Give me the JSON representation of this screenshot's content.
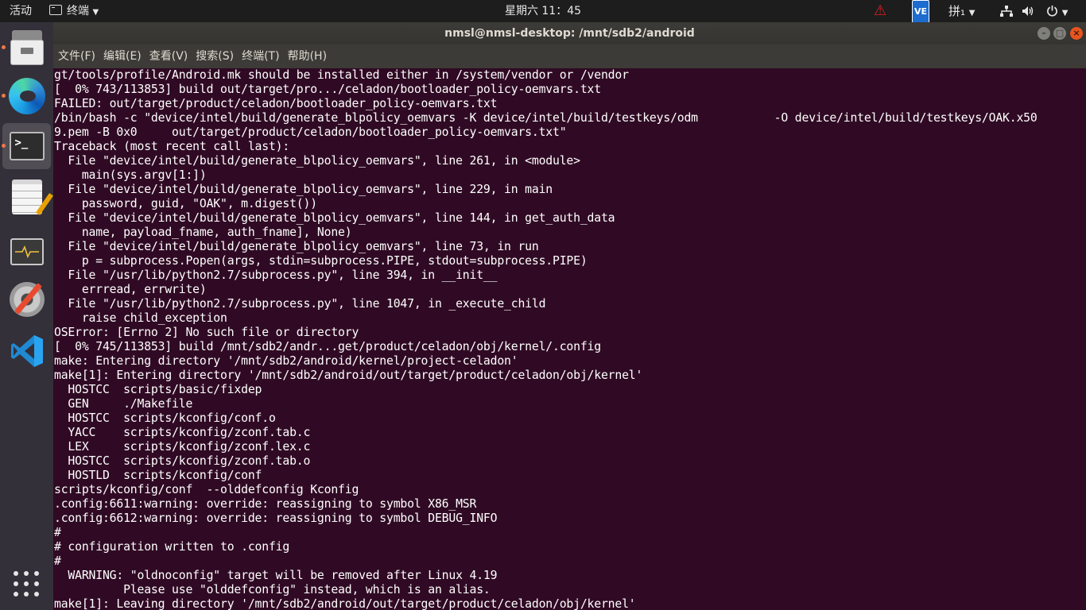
{
  "topbar": {
    "activities": "活动",
    "app_name": "终端",
    "clock": "星期六 11：45",
    "ime": "拼₁",
    "ve_label": "VE",
    "icons": [
      "warning-icon",
      "ve-icon",
      "network-icon",
      "volume-icon",
      "power-icon"
    ]
  },
  "dock": {
    "apps": [
      "files-icon",
      "edge-icon",
      "terminal-icon",
      "text-editor-icon",
      "system-monitor-icon",
      "settings-icon",
      "vscode-icon",
      "show-apps-icon"
    ],
    "terminal_prompt": ">_"
  },
  "window": {
    "title": "nmsl@nmsl-desktop: /mnt/sdb2/android",
    "menu": [
      "文件(F)",
      "编辑(E)",
      "查看(V)",
      "搜索(S)",
      "终端(T)",
      "帮助(H)"
    ]
  },
  "terminal": {
    "lines": [
      "gt/tools/profile/Android.mk should be installed either in /system/vendor or /vendor",
      "[  0% 743/113853] build out/target/pro.../celadon/bootloader_policy-oemvars.txt",
      "FAILED: out/target/product/celadon/bootloader_policy-oemvars.txt",
      "/bin/bash -c \"device/intel/build/generate_blpolicy_oemvars -K device/intel/build/testkeys/odm           -O device/intel/build/testkeys/OAK.x50",
      "9.pem -B 0x0     out/target/product/celadon/bootloader_policy-oemvars.txt\"",
      "Traceback (most recent call last):",
      "  File \"device/intel/build/generate_blpolicy_oemvars\", line 261, in <module>",
      "    main(sys.argv[1:])",
      "  File \"device/intel/build/generate_blpolicy_oemvars\", line 229, in main",
      "    password, guid, \"OAK\", m.digest())",
      "  File \"device/intel/build/generate_blpolicy_oemvars\", line 144, in get_auth_data",
      "    name, payload_fname, auth_fname], None)",
      "  File \"device/intel/build/generate_blpolicy_oemvars\", line 73, in run",
      "    p = subprocess.Popen(args, stdin=subprocess.PIPE, stdout=subprocess.PIPE)",
      "  File \"/usr/lib/python2.7/subprocess.py\", line 394, in __init__",
      "    errread, errwrite)",
      "  File \"/usr/lib/python2.7/subprocess.py\", line 1047, in _execute_child",
      "    raise child_exception",
      "OSError: [Errno 2] No such file or directory",
      "[  0% 745/113853] build /mnt/sdb2/andr...get/product/celadon/obj/kernel/.config",
      "make: Entering directory '/mnt/sdb2/android/kernel/project-celadon'",
      "make[1]: Entering directory '/mnt/sdb2/android/out/target/product/celadon/obj/kernel'",
      "  HOSTCC  scripts/basic/fixdep",
      "  GEN     ./Makefile",
      "  HOSTCC  scripts/kconfig/conf.o",
      "  YACC    scripts/kconfig/zconf.tab.c",
      "  LEX     scripts/kconfig/zconf.lex.c",
      "  HOSTCC  scripts/kconfig/zconf.tab.o",
      "  HOSTLD  scripts/kconfig/conf",
      "scripts/kconfig/conf  --olddefconfig Kconfig",
      ".config:6611:warning: override: reassigning to symbol X86_MSR",
      ".config:6612:warning: override: reassigning to symbol DEBUG_INFO",
      "#",
      "# configuration written to .config",
      "#",
      "  WARNING: \"oldnoconfig\" target will be removed after Linux 4.19",
      "          Please use \"olddefconfig\" instead, which is an alias.",
      "make[1]: Leaving directory '/mnt/sdb2/android/out/target/product/celadon/obj/kernel'"
    ]
  },
  "colors": {
    "terminal_bg": "#300a24",
    "dock_bg": "#34303a",
    "topbar_bg": "#1d1d1d",
    "accent_orange": "#e9541f",
    "running_indicator": "#f07746"
  }
}
